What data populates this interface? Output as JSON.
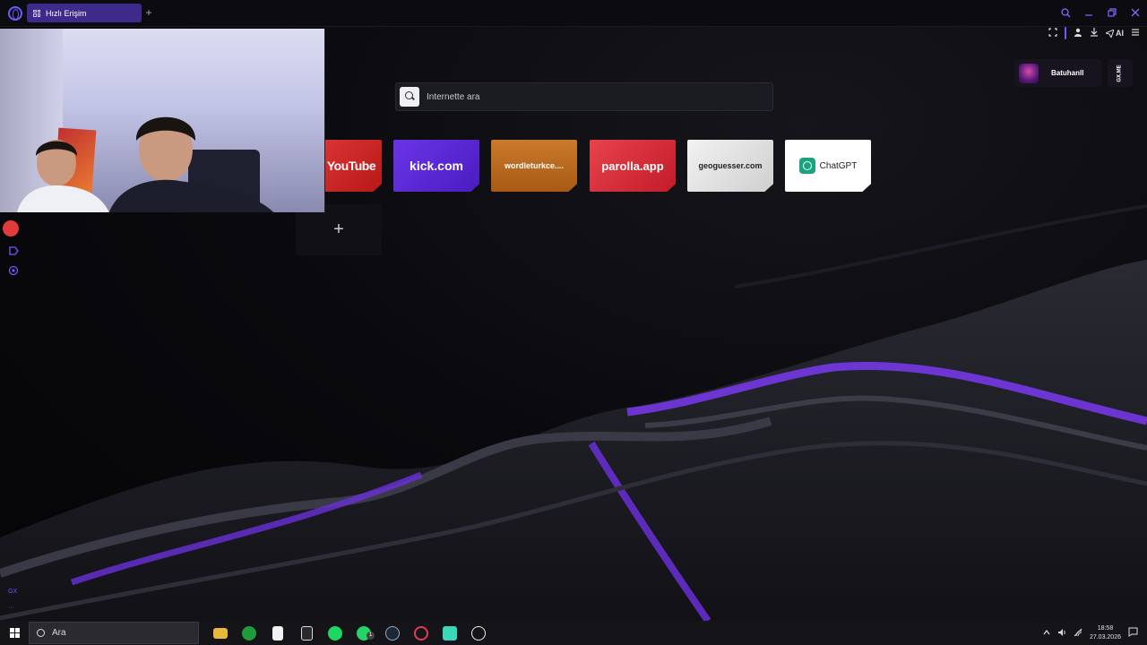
{
  "browser": {
    "tab_label": "Hızlı Erişim",
    "new_tab": "+",
    "toolbar_ai": "AI"
  },
  "profile": {
    "name": "Batuhanll",
    "badge": "GX.ME"
  },
  "search": {
    "placeholder": "İnternette ara"
  },
  "speed_dials": [
    {
      "label": "YouTube"
    },
    {
      "label": "kick.com"
    },
    {
      "label": "wordleturkce...."
    },
    {
      "label": "parolla.app"
    },
    {
      "label": "geoguesser.com"
    },
    {
      "label": "ChatGPT"
    }
  ],
  "add_dial": "+",
  "sidebar": {
    "gx_label": "GX",
    "more_label": "···"
  },
  "taskbar": {
    "search_placeholder": "Ara",
    "apps": [
      "file-explorer",
      "xbox",
      "notepad",
      "epic-games",
      "spotify",
      "whatsapp",
      "steam",
      "opera-gx",
      "app-green",
      "app-circle"
    ],
    "whatsapp_badge": "1",
    "time": "18:58",
    "date": "27.03.2026"
  },
  "colors": {
    "accent": "#6a5cff",
    "tab": "#3d2a8a",
    "youtube": "#e23b3b",
    "kick": "#5a28d6",
    "wordle": "#b8691f",
    "parolla": "#d8303c"
  }
}
